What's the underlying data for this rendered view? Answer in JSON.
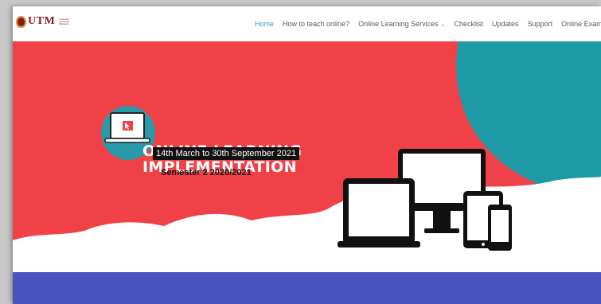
{
  "brand": {
    "logo_text": "UTM",
    "logo_subtext": "Universiti Teknologi Malaysia"
  },
  "nav": {
    "items": [
      {
        "label": "Home",
        "active": true
      },
      {
        "label": "How to teach online?",
        "active": false
      },
      {
        "label": "Online Learning Services",
        "active": false,
        "dropdown": true
      },
      {
        "label": "Checklist",
        "active": false
      },
      {
        "label": "Updates",
        "active": false
      },
      {
        "label": "Support",
        "active": false
      },
      {
        "label": "Online Exam",
        "active": false
      }
    ],
    "chevron": "⌄"
  },
  "banner": {
    "title_line1": "ONLINE LEARNING",
    "title_line2": "IMPLEMENTATION",
    "dates": "14th March to 30th September 2021",
    "semester": "Semester 2 2020/2021"
  },
  "colors": {
    "accent": "#2a9fd6",
    "banner_red": "#ef4147",
    "banner_teal": "#1e9aa6",
    "strip_blue": "#4b52c1"
  },
  "icons": [
    "laptop-cursor-icon",
    "desktop-icon",
    "laptop-icon",
    "tablet-icon",
    "phone-icon",
    "user-icon"
  ]
}
